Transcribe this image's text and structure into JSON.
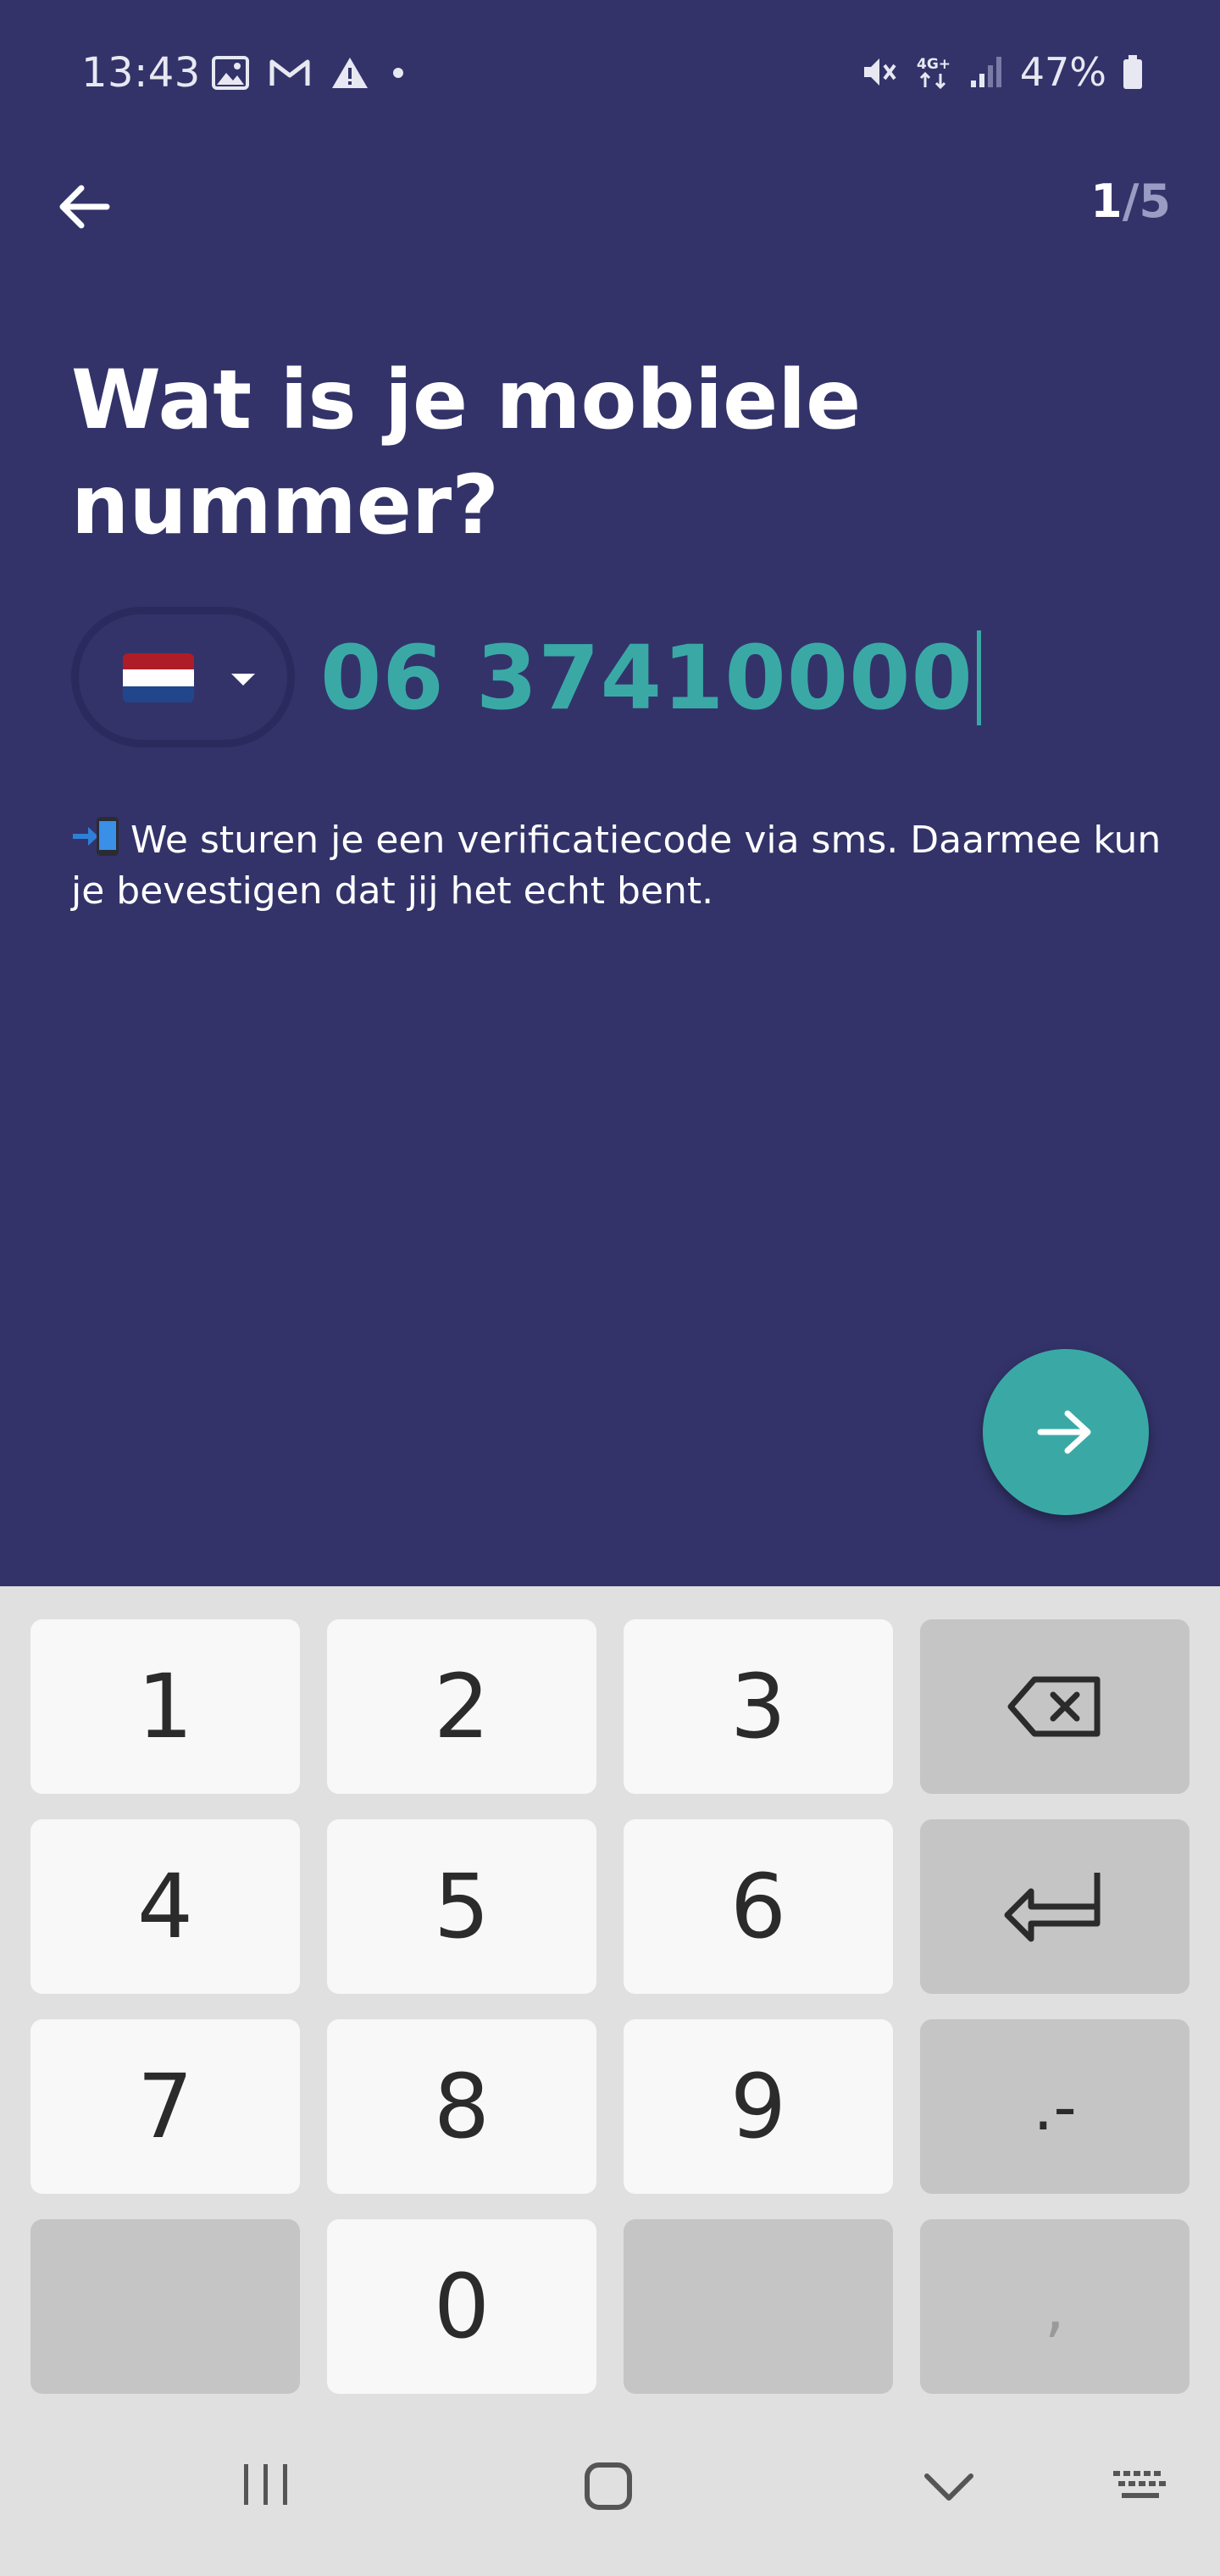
{
  "status_bar": {
    "time": "13:43",
    "battery_percent": "47%",
    "network": "4G+",
    "left_icons": [
      "image-icon",
      "gmail-icon",
      "warning-icon",
      "dot-icon"
    ],
    "right_icons": [
      "vibrate-mute-icon",
      "network-4g-icon",
      "signal-icon",
      "battery-icon"
    ]
  },
  "header": {
    "step_current": "1",
    "step_separator": "/",
    "step_total": "5"
  },
  "form": {
    "title": "Wat is je mobiele nummer?",
    "country_flag": "NL",
    "flag_colors": [
      "#ae1c28",
      "#ffffff",
      "#21468b"
    ],
    "phone_value": "06 37410000",
    "info_text": "We sturen je een verificatiecode via sms. Daarmee kun je bevestigen dat jij het echt bent."
  },
  "colors": {
    "background": "#33336a",
    "accent": "#3aa9a6",
    "keyboard_bg": "#e0e0e0"
  },
  "keyboard": {
    "keys": [
      "1",
      "2",
      "3",
      "4",
      "5",
      "6",
      "7",
      "8",
      "9",
      "0"
    ],
    "symbol_key": ".-",
    "comma_key": ","
  }
}
